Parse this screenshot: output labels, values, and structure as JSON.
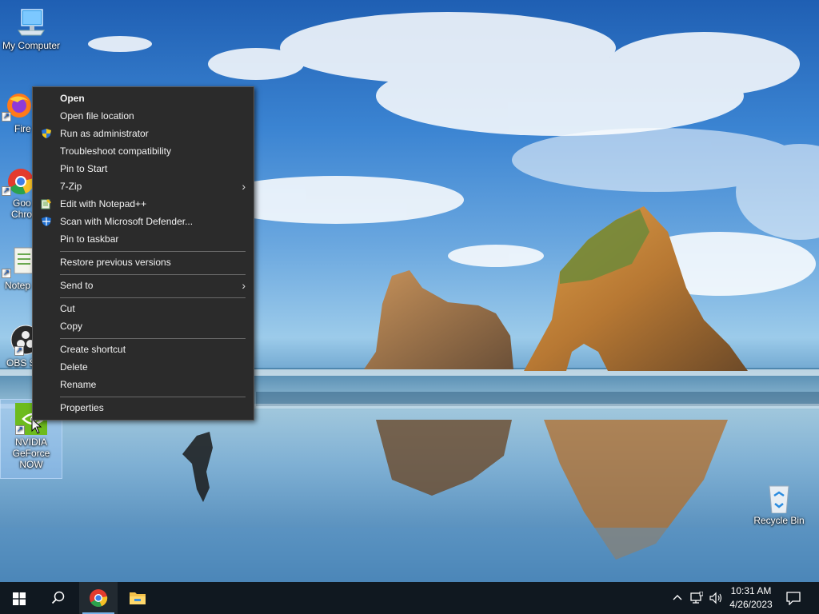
{
  "desktop": {
    "icons": [
      {
        "label": "My Computer",
        "icon": "computer-icon"
      },
      {
        "label": "Fire",
        "icon": "firefox-icon"
      },
      {
        "label": "Goo",
        "label2": "Chro",
        "icon": "chrome-icon"
      },
      {
        "label": "Notep",
        "icon": "notepad-icon"
      },
      {
        "label": "OBS S",
        "icon": "obs-icon"
      },
      {
        "label": "NVIDIA GeForce NOW",
        "icon": "nvidia-icon"
      },
      {
        "label": "Recycle Bin",
        "icon": "recycle-bin-icon"
      }
    ]
  },
  "context_menu": {
    "items": [
      {
        "label": "Open",
        "bold": true
      },
      {
        "label": "Open file location"
      },
      {
        "label": "Run as administrator",
        "icon": "uac-shield-icon"
      },
      {
        "label": "Troubleshoot compatibility"
      },
      {
        "label": "Pin to Start"
      },
      {
        "label": "7-Zip",
        "submenu": true
      },
      {
        "label": "Edit with Notepad++",
        "icon": "notepad-plus-plus-icon"
      },
      {
        "label": "Scan with Microsoft Defender...",
        "icon": "defender-icon"
      },
      {
        "label": "Pin to taskbar"
      },
      {
        "label": "Restore previous versions"
      },
      {
        "label": "Send to",
        "submenu": true
      },
      {
        "label": "Cut"
      },
      {
        "label": "Copy"
      },
      {
        "label": "Create shortcut"
      },
      {
        "label": "Delete"
      },
      {
        "label": "Rename"
      },
      {
        "label": "Properties"
      }
    ]
  },
  "taskbar": {
    "start": "windows-start-icon",
    "search": "search-icon",
    "pinned": [
      "chrome-icon",
      "file-explorer-icon"
    ],
    "tray_icons": [
      "chevron-up-icon",
      "network-icon",
      "volume-icon"
    ],
    "time": "10:31 AM",
    "date": "4/26/2023",
    "notifications": "action-center-icon"
  },
  "colors": {
    "menu_bg": "#2b2b2b",
    "taskbar_bg": "#101820",
    "accent": "#7ab3e8"
  }
}
